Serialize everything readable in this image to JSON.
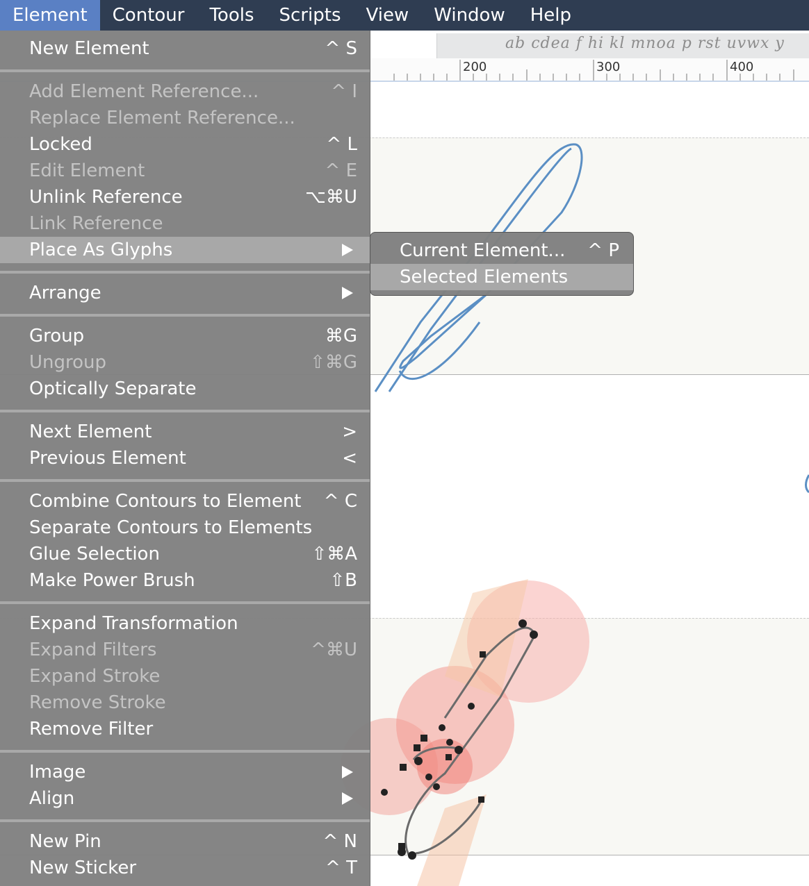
{
  "menubar": {
    "items": [
      "Element",
      "Contour",
      "Tools",
      "Scripts",
      "View",
      "Window",
      "Help"
    ],
    "active": "Element"
  },
  "canvas": {
    "preview_text": "ab cdea f  hi  kl mnoa p rst  uvwx y",
    "ruler_labels": [
      "200",
      "300",
      "400"
    ]
  },
  "element_menu": {
    "new_element": {
      "label": "New Element",
      "shortcut": "^ S"
    },
    "add_element_reference": {
      "label": "Add Element Reference...",
      "shortcut": "^ I"
    },
    "replace_element_reference": {
      "label": "Replace Element Reference...",
      "shortcut": ""
    },
    "locked": {
      "label": "Locked",
      "shortcut": "^ L"
    },
    "edit_element": {
      "label": "Edit Element",
      "shortcut": "^ E"
    },
    "unlink_reference": {
      "label": "Unlink Reference",
      "shortcut": "⌥⌘U"
    },
    "link_reference": {
      "label": "Link Reference",
      "shortcut": ""
    },
    "place_as_glyphs": {
      "label": "Place As Glyphs",
      "shortcut": ""
    },
    "arrange": {
      "label": "Arrange",
      "shortcut": ""
    },
    "group": {
      "label": "Group",
      "shortcut": "⌘G"
    },
    "ungroup": {
      "label": "Ungroup",
      "shortcut": "⇧⌘G"
    },
    "optically_separate": {
      "label": "Optically Separate",
      "shortcut": ""
    },
    "next_element": {
      "label": "Next Element",
      "shortcut": ">"
    },
    "previous_element": {
      "label": "Previous Element",
      "shortcut": "<"
    },
    "combine_contours": {
      "label": "Combine Contours to Element",
      "shortcut": "^ C"
    },
    "separate_contours": {
      "label": "Separate Contours to Elements",
      "shortcut": ""
    },
    "glue_selection": {
      "label": "Glue Selection",
      "shortcut": "⇧⌘A"
    },
    "make_power_brush": {
      "label": "Make Power Brush",
      "shortcut": "⇧B"
    },
    "expand_transformation": {
      "label": "Expand Transformation",
      "shortcut": ""
    },
    "expand_filters": {
      "label": "Expand Filters",
      "shortcut": "^⌘U"
    },
    "expand_stroke": {
      "label": "Expand Stroke",
      "shortcut": ""
    },
    "remove_stroke": {
      "label": "Remove Stroke",
      "shortcut": ""
    },
    "remove_filter": {
      "label": "Remove Filter",
      "shortcut": ""
    },
    "image": {
      "label": "Image",
      "shortcut": ""
    },
    "align": {
      "label": "Align",
      "shortcut": ""
    },
    "new_pin": {
      "label": "New Pin",
      "shortcut": "^ N"
    },
    "new_sticker": {
      "label": "New Sticker",
      "shortcut": "^ T"
    }
  },
  "submenu": {
    "current_element": {
      "label": "Current Element...",
      "shortcut": "^ P"
    },
    "selected_elements": {
      "label": "Selected Elements",
      "shortcut": ""
    }
  },
  "colors": {
    "menubar_bg": "#2f3d52",
    "menubar_active": "#5a80c4",
    "menu_bg": "#808080",
    "highlight": "#a8a8a8",
    "glyph_outline": "#5b8fc4"
  }
}
